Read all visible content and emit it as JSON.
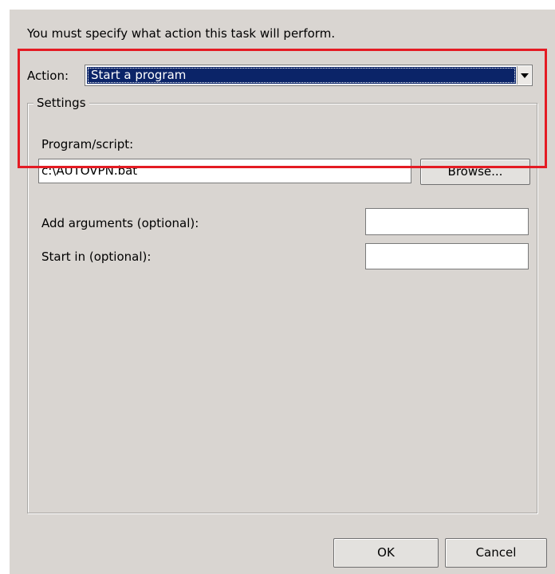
{
  "instruction": "You must specify what action this task will perform.",
  "action": {
    "label": "Action:",
    "selected": "Start a program"
  },
  "settings": {
    "legend": "Settings",
    "program_label": "Program/script:",
    "program_value": "c:\\AUTOVPN.bat",
    "browse_label": "Browse...",
    "arguments_label": "Add arguments (optional):",
    "arguments_value": "",
    "start_in_label": "Start in (optional):",
    "start_in_value": ""
  },
  "buttons": {
    "ok": "OK",
    "cancel": "Cancel"
  },
  "colors": {
    "dialog_background": "#d9d5d1",
    "selection_highlight": "#0b2468",
    "annotation_border": "#e41b23"
  },
  "icons": {
    "dropdown": "chevron-down-icon"
  }
}
